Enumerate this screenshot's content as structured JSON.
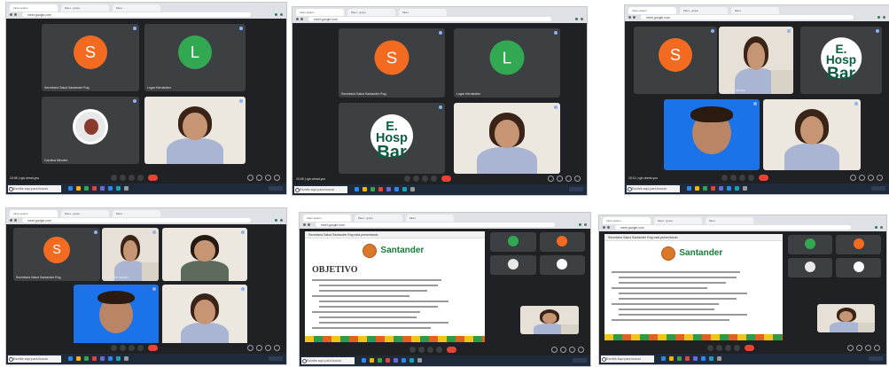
{
  "shots": [
    {
      "id": "top-left",
      "tabs": [
        "Inicio sesión",
        "Meet - grupo",
        "Meet"
      ],
      "url": "meet.google.com",
      "tiles": [
        {
          "kind": "avatar",
          "letter": "S",
          "name": "Secretaría Salud Santander Rug"
        },
        {
          "kind": "avatar",
          "letter": "L",
          "name": "Lugar Hernández"
        },
        {
          "kind": "image",
          "name": "Carolina Méndez"
        },
        {
          "kind": "photo",
          "name": ""
        }
      ],
      "call_time": "10:06 | rgh-ohmd-yco",
      "taskbar_search": "Escribe aquí para buscar"
    },
    {
      "id": "top-middle",
      "tabs": [
        "Inicio sesión",
        "Meet - grupo",
        "Meet"
      ],
      "url": "meet.google.com",
      "tiles": [
        {
          "kind": "avatar",
          "letter": "S",
          "name": "Secretaría Salud Santander Rug"
        },
        {
          "kind": "avatar",
          "letter": "L",
          "name": "Lugar Hernández"
        },
        {
          "kind": "hospital",
          "line1": "E. Hosp",
          "line2": "Bar",
          "name": ""
        },
        {
          "kind": "photo",
          "name": ""
        }
      ],
      "call_time": "10:09 | rgh-ohmd-yco",
      "taskbar_search": "Escribe aquí para buscar"
    },
    {
      "id": "top-right",
      "tabs": [
        "Inicio sesión",
        "Meet - grupo",
        "Meet"
      ],
      "url": "meet.google.com",
      "tiles": [
        {
          "kind": "avatar",
          "letter": "S",
          "name": ""
        },
        {
          "kind": "photo",
          "name": "Lugar Hernández"
        },
        {
          "kind": "hospital",
          "line1": "E. Hosp",
          "line2": "Bar",
          "name": ""
        },
        {
          "kind": "photo",
          "name": ""
        },
        {
          "kind": "photo",
          "name": ""
        }
      ],
      "call_time": "10:11 | rgh-ohmd-yco",
      "taskbar_search": "Escribe aquí para buscar"
    },
    {
      "id": "bottom-left",
      "tabs": [
        "Inicio sesión",
        "Meet - grupo",
        "Meet"
      ],
      "url": "meet.google.com",
      "tiles": [
        {
          "kind": "avatar",
          "letter": "S",
          "name": "Secretaría Salud Santander Rug"
        },
        {
          "kind": "photo",
          "name": "Lugar Hernández"
        },
        {
          "kind": "photo",
          "name": ""
        },
        {
          "kind": "photo",
          "name": ""
        },
        {
          "kind": "photo",
          "name": ""
        }
      ],
      "call_time": "",
      "taskbar_search": "Escribe aquí para buscar"
    },
    {
      "id": "bottom-middle",
      "tabs": [
        "Inicio sesión",
        "Meet - grupo",
        "Meet"
      ],
      "url": "meet.google.com",
      "presentation_header": "Secretaría Salud Santander Rug está presentando",
      "slide_brand": "Santander",
      "slide_title": "OBJETIVO",
      "call_time": "",
      "taskbar_search": "Escribe aquí para buscar"
    },
    {
      "id": "bottom-right",
      "tabs": [
        "Inicio sesión",
        "Meet - grupo",
        "Meet"
      ],
      "url": "meet.google.com",
      "presentation_header": "Secretaría Salud Santander Rug está presentando",
      "slide_brand": "Santander",
      "call_time": "",
      "taskbar_search": "Escribe aquí para buscar"
    }
  ],
  "colors": {
    "avatar_orange": "#f26b21",
    "avatar_green": "#33a853",
    "meet_bg": "#202124",
    "tile_bg": "#3c4043",
    "end_call": "#ea4335",
    "highlight_blue": "#1a73e8"
  },
  "icons": [
    "mic-icon",
    "camera-icon",
    "captions-icon",
    "present-icon",
    "end-call-icon",
    "info-icon",
    "people-icon",
    "chat-icon",
    "search-icon",
    "windows-icon"
  ]
}
